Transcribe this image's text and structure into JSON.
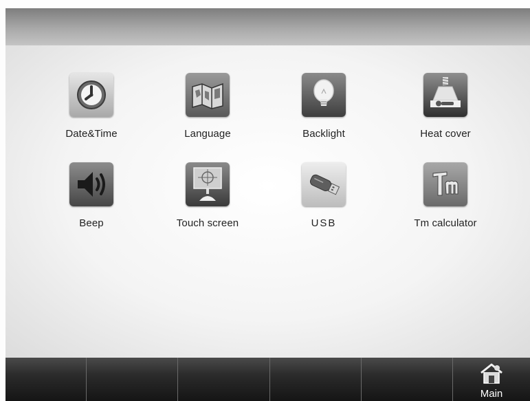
{
  "settings": {
    "items": [
      {
        "label": "Date&Time",
        "icon": "clock-icon"
      },
      {
        "label": "Language",
        "icon": "map-icon"
      },
      {
        "label": "Backlight",
        "icon": "lightbulb-icon"
      },
      {
        "label": "Heat cover",
        "icon": "heat-cover-icon"
      },
      {
        "label": "Beep",
        "icon": "speaker-icon"
      },
      {
        "label": "Touch screen",
        "icon": "touch-screen-icon"
      },
      {
        "label": "USB",
        "icon": "usb-drive-icon"
      },
      {
        "label": "Tm calculator",
        "icon": "tm-calculator-icon"
      }
    ]
  },
  "bottom_bar": {
    "main_label": "Main",
    "main_icon": "home-icon"
  }
}
